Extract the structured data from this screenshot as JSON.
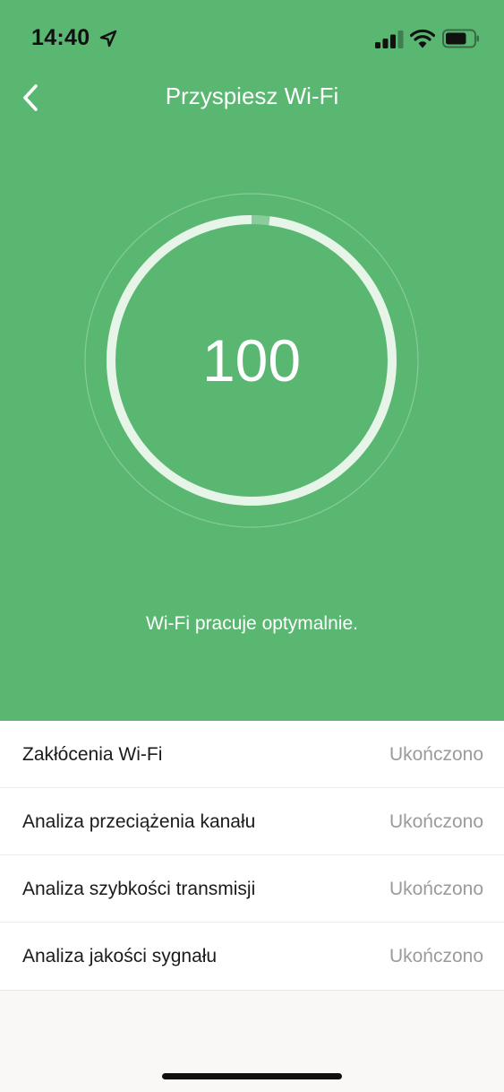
{
  "status_bar": {
    "time": "14:40",
    "location_icon": "location-arrow-icon",
    "signal_icon": "cellular-signal-icon",
    "wifi_icon": "wifi-icon",
    "battery_icon": "battery-icon",
    "battery_level": 0.75
  },
  "nav": {
    "back_icon": "chevron-left-icon",
    "title": "Przyspiesz Wi-Fi"
  },
  "gauge": {
    "value": "100",
    "progress": 1.0
  },
  "status_message": "Wi-Fi pracuje optymalnie.",
  "checks": [
    {
      "label": "Zakłócenia Wi-Fi",
      "status": "Ukończono"
    },
    {
      "label": "Analiza przeciążenia kanału",
      "status": "Ukończono"
    },
    {
      "label": "Analiza szybkości transmisji",
      "status": "Ukończono"
    },
    {
      "label": "Analiza jakości sygnału",
      "status": "Ukończono"
    }
  ],
  "colors": {
    "accent": "#5ab772",
    "ring": "#e6f5e8",
    "background": "#f9f8f6"
  }
}
